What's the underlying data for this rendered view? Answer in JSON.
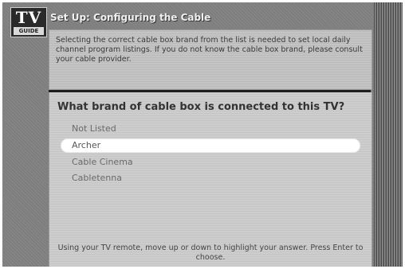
{
  "header": {
    "logo_top": "TV",
    "logo_bottom": "GUIDE",
    "title": "Set Up: Configuring the Cable"
  },
  "top_panel": {
    "instruction": "Selecting the correct cable box brand from the list is needed to set local daily channel program listings. If you do not know the cable box brand, please consult your cable provider."
  },
  "main": {
    "question": "What brand of cable box is connected to this TV?",
    "options": [
      {
        "label": "Not Listed",
        "selected": false
      },
      {
        "label": "Archer",
        "selected": true
      },
      {
        "label": "Cable Cinema",
        "selected": false
      },
      {
        "label": "Cabletenna",
        "selected": false
      }
    ],
    "footer_note": "Using your TV remote, move up or down to highlight your answer. Press Enter to choose."
  }
}
